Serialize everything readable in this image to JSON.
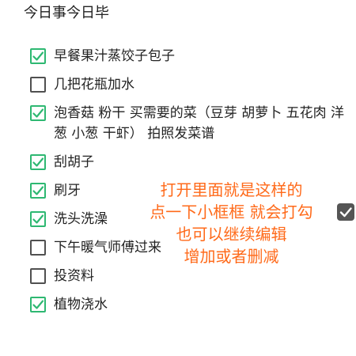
{
  "title": "今日事今日毕",
  "colors": {
    "check_green": "#2eb872",
    "annotation_orange": "#ff6a1a"
  },
  "items": [
    {
      "label": "早餐果汁蒸饺子包子",
      "checked": true
    },
    {
      "label": "几把花瓶加水",
      "checked": false
    },
    {
      "label": "泡香菇 粉干 买需要的菜（豆芽 胡萝卜 五花肉 洋葱 小葱 干虾） 拍照发菜谱",
      "checked": true
    },
    {
      "label": "刮胡子",
      "checked": true
    },
    {
      "label": "刷牙",
      "checked": true
    },
    {
      "label": "洗头洗澡",
      "checked": true
    },
    {
      "label": "下午暖气师傅过来",
      "checked": false
    },
    {
      "label": "投资料",
      "checked": false
    },
    {
      "label": "植物浇水",
      "checked": true
    }
  ],
  "annotation": {
    "line1": "打开里面就是这样的",
    "line2": "点一下小框框 就会打勾",
    "line3": "也可以继续编辑",
    "line4": "增加或者删减"
  },
  "edge_checkbox": {
    "icon": "checkbox-checked-icon",
    "checked": true
  }
}
